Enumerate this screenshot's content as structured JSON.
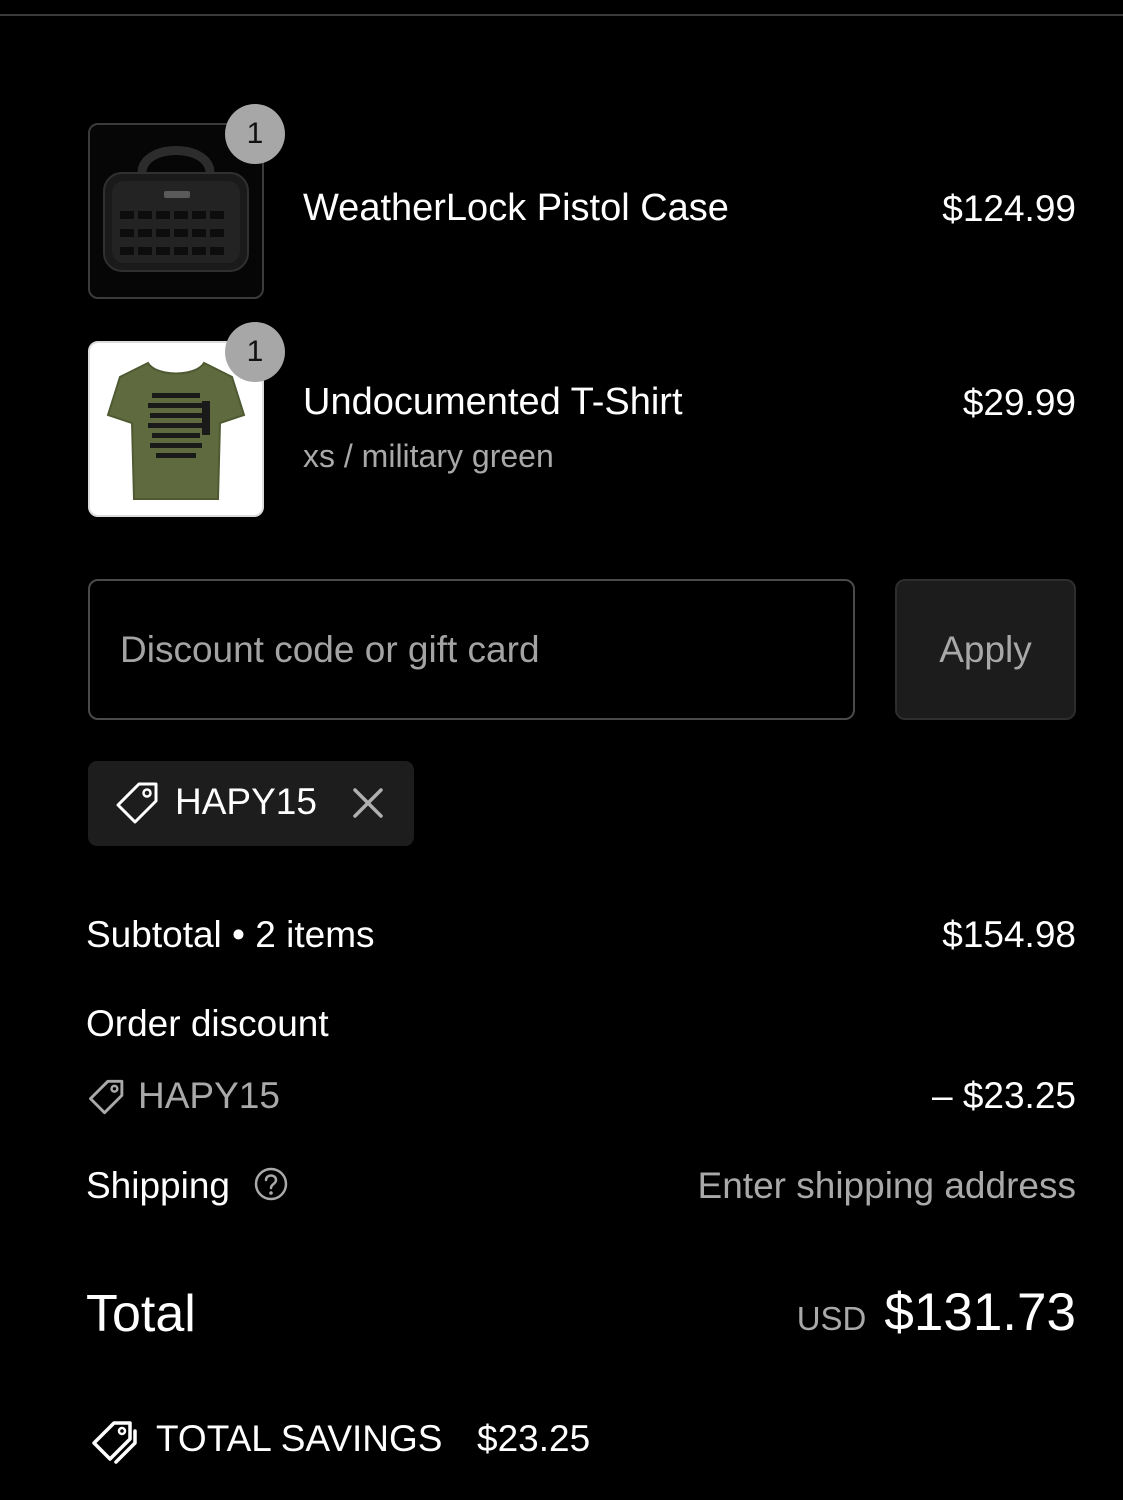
{
  "cart": {
    "items": [
      {
        "name": "WeatherLock Pistol Case",
        "variant": "",
        "price": "$124.99",
        "quantity": "1",
        "thumbnail": "pistol-case-image"
      },
      {
        "name": "Undocumented T-Shirt",
        "variant": "xs / military green",
        "price": "$29.99",
        "quantity": "1",
        "thumbnail": "t-shirt-image"
      }
    ]
  },
  "discount": {
    "placeholder": "Discount code or gift card",
    "value": "",
    "apply_label": "Apply",
    "applied_code": "HAPY15"
  },
  "summary": {
    "subtotal_label": "Subtotal • 2 items",
    "subtotal_value": "$154.98",
    "order_discount_label": "Order discount",
    "order_discount_code": "HAPY15",
    "order_discount_value": "– $23.25",
    "shipping_label": "Shipping",
    "shipping_value": "Enter shipping address",
    "total_label": "Total",
    "currency": "USD",
    "total_value": "$131.73",
    "savings_label": "TOTAL SAVINGS",
    "savings_value": "$23.25"
  },
  "colors": {
    "background": "#000000",
    "text": "#ffffff",
    "muted_text": "#a9a9a9",
    "chip_background": "#1d1d1d",
    "badge": "#a7a7a7"
  }
}
